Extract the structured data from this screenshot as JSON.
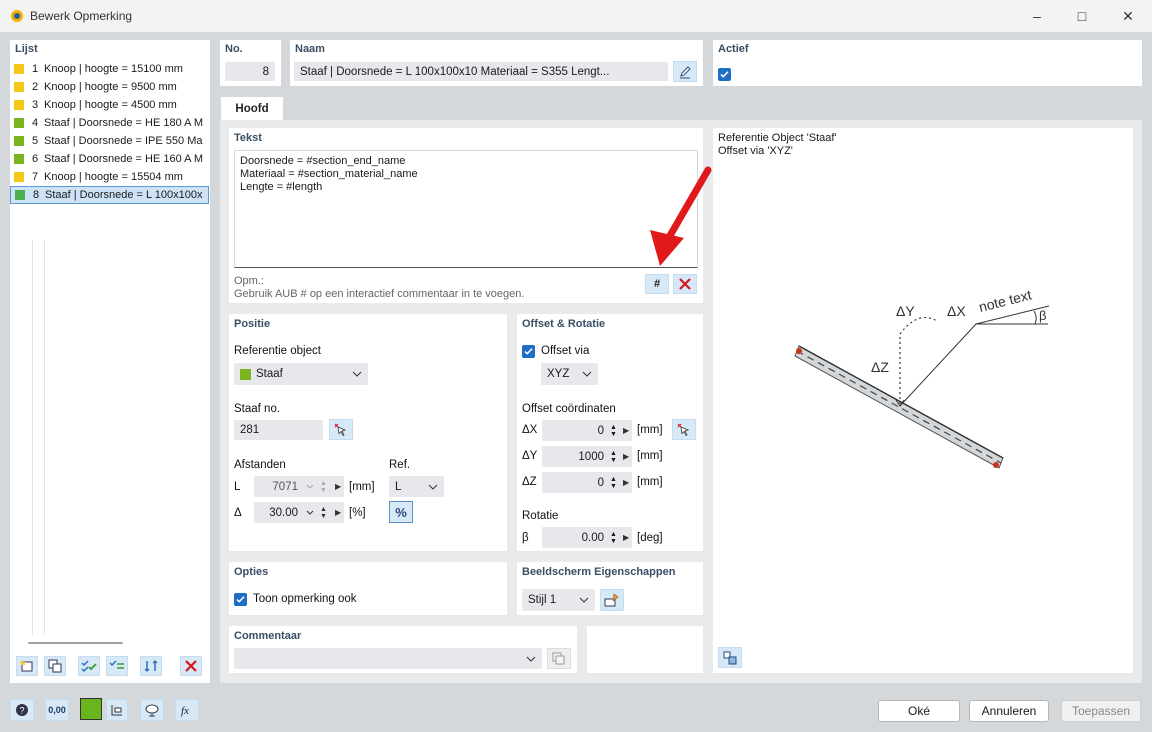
{
  "window": {
    "title": "Bewerk Opmerking"
  },
  "list": {
    "header": "Lijst",
    "items": [
      {
        "num": "1",
        "label": "Knoop | hoogte = 15100 mm",
        "color": "#f5c518"
      },
      {
        "num": "2",
        "label": "Knoop | hoogte = 9500 mm",
        "color": "#f5c518"
      },
      {
        "num": "3",
        "label": "Knoop | hoogte = 4500 mm",
        "color": "#f5c518"
      },
      {
        "num": "4",
        "label": "Staaf | Doorsnede = HE 180 A M",
        "color": "#7ab51d"
      },
      {
        "num": "5",
        "label": "Staaf | Doorsnede = IPE 550 Ma",
        "color": "#7ab51d"
      },
      {
        "num": "6",
        "label": "Staaf | Doorsnede = HE 160 A M",
        "color": "#7ab51d"
      },
      {
        "num": "7",
        "label": "Knoop | hoogte = 15504 mm",
        "color": "#f5c518"
      },
      {
        "num": "8",
        "label": "Staaf | Doorsnede = L 100x100x",
        "color": "#4caf50"
      }
    ]
  },
  "header": {
    "no_label": "No.",
    "no_value": "8",
    "naam_label": "Naam",
    "naam_value": "Staaf | Doorsnede = L 100x100x10 Materiaal = S355 Lengt...",
    "actief_label": "Actief"
  },
  "tabs": [
    {
      "label": "Hoofd"
    }
  ],
  "tekst": {
    "title": "Tekst",
    "lines": [
      "Doorsnede = #section_end_name",
      "Materiaal = #section_material_name",
      "Lengte = #length"
    ],
    "opm_label": "Opm.:",
    "opm_text": "Gebruik AUB # op een interactief commentaar in te voegen.",
    "hash_button": "#"
  },
  "positie": {
    "title": "Positie",
    "ref_object_label": "Referentie object",
    "ref_object_value": "Staaf",
    "staaf_no_label": "Staaf no.",
    "staaf_no_value": "281",
    "afstanden_label": "Afstanden",
    "ref_label": "Ref.",
    "L_label": "L",
    "L_value": "7071",
    "L_unit": "[mm]",
    "delta_label": "Δ",
    "delta_value": "30.00",
    "delta_unit": "[%]",
    "ref_value": "L",
    "percent_button": "%"
  },
  "offset": {
    "title": "Offset & Rotatie",
    "offset_via_label": "Offset via",
    "offset_via_value": "XYZ",
    "coords_label": "Offset coördinaten",
    "dx_label": "ΔX",
    "dx_value": "0",
    "dx_unit": "[mm]",
    "dy_label": "ΔY",
    "dy_value": "1000",
    "dy_unit": "[mm]",
    "dz_label": "ΔZ",
    "dz_value": "0",
    "dz_unit": "[mm]",
    "rotatie_label": "Rotatie",
    "beta_label": "β",
    "beta_value": "0.00",
    "beta_unit": "[deg]"
  },
  "opties": {
    "title": "Opties",
    "toon_label": "Toon opmerking ook"
  },
  "beeld": {
    "title": "Beeldscherm Eigenschappen",
    "stijl_value": "Stijl 1"
  },
  "commentaar": {
    "title": "Commentaar",
    "value": ""
  },
  "preview": {
    "line1": "Referentie Object 'Staaf'",
    "line2": "Offset via 'XYZ'",
    "note_text": "note text",
    "dy": "ΔY",
    "dx": "ΔX",
    "dz": "ΔZ",
    "beta": "β"
  },
  "footer": {
    "ok": "Oké",
    "annuleren": "Annuleren",
    "toepassen": "Toepassen",
    "decimals": "0,00"
  }
}
